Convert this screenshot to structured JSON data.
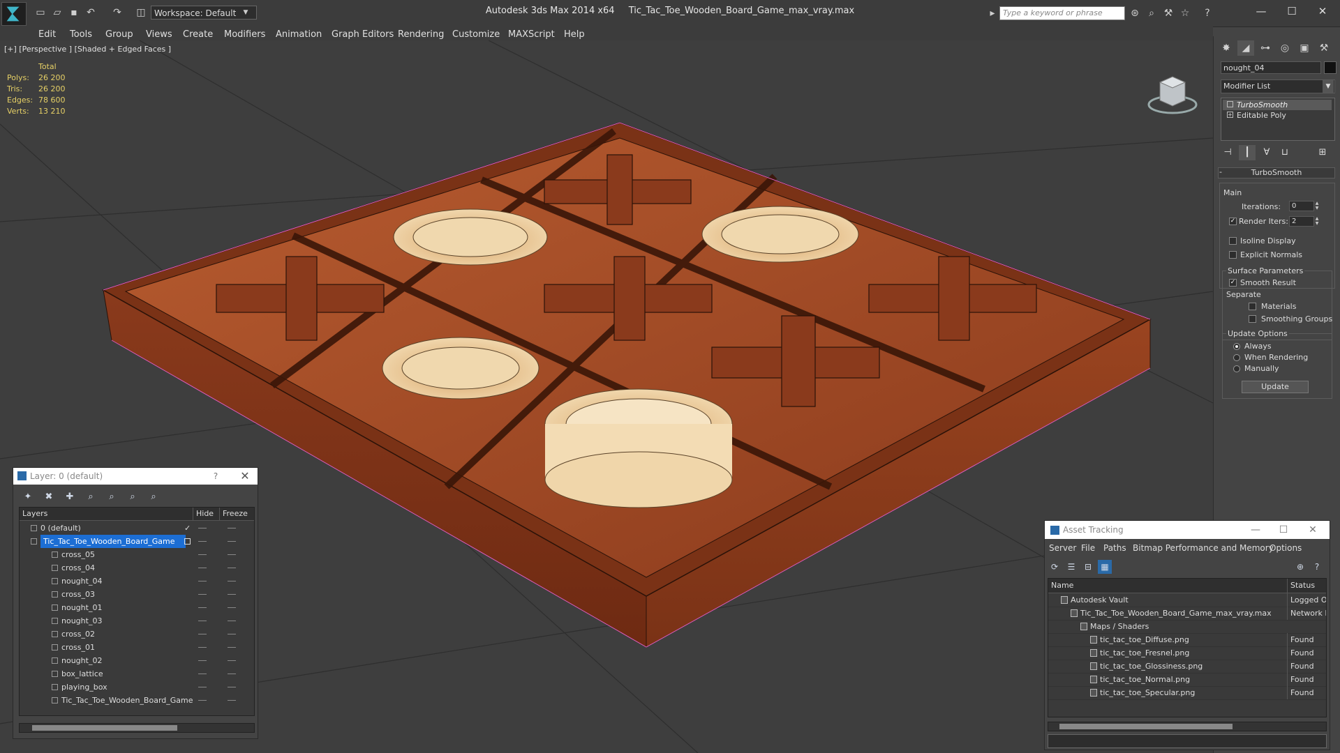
{
  "window": {
    "app_name": "Autodesk 3ds Max  2014 x64",
    "file_name": "Tic_Tac_Toe_Wooden_Board_Game_max_vray.max"
  },
  "toolbar": {
    "workspace": "Workspace: Default",
    "search_placeholder": "Type a keyword or phrase"
  },
  "menu": [
    "Edit",
    "Tools",
    "Group",
    "Views",
    "Create",
    "Modifiers",
    "Animation",
    "Graph Editors",
    "Rendering",
    "Customize",
    "MAXScript",
    "Help"
  ],
  "viewport": {
    "label": "[+] [Perspective ] [Shaded + Edged Faces ]",
    "stats": {
      "header": "Total",
      "rows": [
        {
          "k": "Polys:",
          "v": "26 200"
        },
        {
          "k": "Tris:",
          "v": "26 200"
        },
        {
          "k": "Edges:",
          "v": "78 600"
        },
        {
          "k": "Verts:",
          "v": "13 210"
        }
      ]
    }
  },
  "command_panel": {
    "object_name": "nought_04",
    "modifier_list": "Modifier List",
    "stack": [
      "TurboSmooth",
      "Editable Poly"
    ],
    "rollout_title": "TurboSmooth",
    "main_group": "Main",
    "iterations_label": "Iterations:",
    "iterations_value": "0",
    "render_iters_label": "Render Iters:",
    "render_iters_value": "2",
    "isoline_label": "Isoline Display",
    "explicit_normals_label": "Explicit Normals",
    "surface_params_label": "Surface Parameters",
    "smooth_result_label": "Smooth Result",
    "separate_label": "Separate",
    "materials_label": "Materials",
    "smoothing_groups_label": "Smoothing Groups",
    "update_options_label": "Update Options",
    "always_label": "Always",
    "when_rendering_label": "When Rendering",
    "manually_label": "Manually",
    "update_button": "Update"
  },
  "layer_panel": {
    "title": "Layer: 0 (default)",
    "help": "?",
    "col_layers": "Layers",
    "col_hide": "Hide",
    "col_freeze": "Freeze",
    "rows": [
      {
        "name": "0 (default)",
        "level": 0
      },
      {
        "name": "Tic_Tac_Toe_Wooden_Board_Game",
        "level": 0
      },
      {
        "name": "cross_05",
        "level": 1
      },
      {
        "name": "cross_04",
        "level": 1
      },
      {
        "name": "nought_04",
        "level": 1
      },
      {
        "name": "cross_03",
        "level": 1
      },
      {
        "name": "nought_01",
        "level": 1
      },
      {
        "name": "nought_03",
        "level": 1
      },
      {
        "name": "cross_02",
        "level": 1
      },
      {
        "name": "cross_01",
        "level": 1
      },
      {
        "name": "nought_02",
        "level": 1
      },
      {
        "name": "box_lattice",
        "level": 1
      },
      {
        "name": "playing_box",
        "level": 1
      },
      {
        "name": "Tic_Tac_Toe_Wooden_Board_Game",
        "level": 1
      }
    ]
  },
  "asset_panel": {
    "title": "Asset Tracking",
    "menu": [
      "Server",
      "File",
      "Paths",
      "Bitmap Performance and Memory",
      "Options"
    ],
    "col_name": "Name",
    "col_status": "Status",
    "rows": [
      {
        "name": "Autodesk Vault",
        "status": "Logged Out",
        "indent": 1
      },
      {
        "name": "Tic_Tac_Toe_Wooden_Board_Game_max_vray.max",
        "status": "Network Path",
        "indent": 2
      },
      {
        "name": "Maps / Shaders",
        "status": "",
        "indent": 3
      },
      {
        "name": "tic_tac_toe_Diffuse.png",
        "status": "Found",
        "indent": 4
      },
      {
        "name": "tic_tac_toe_Fresnel.png",
        "status": "Found",
        "indent": 4
      },
      {
        "name": "tic_tac_toe_Glossiness.png",
        "status": "Found",
        "indent": 4
      },
      {
        "name": "tic_tac_toe_Normal.png",
        "status": "Found",
        "indent": 4
      },
      {
        "name": "tic_tac_toe_Specular.png",
        "status": "Found",
        "indent": 4
      }
    ]
  },
  "colors": {
    "selection": "#1c6ed4",
    "wood": "#8a3a1c",
    "nought": "#e8c594",
    "stat_text": "#e6d066"
  }
}
